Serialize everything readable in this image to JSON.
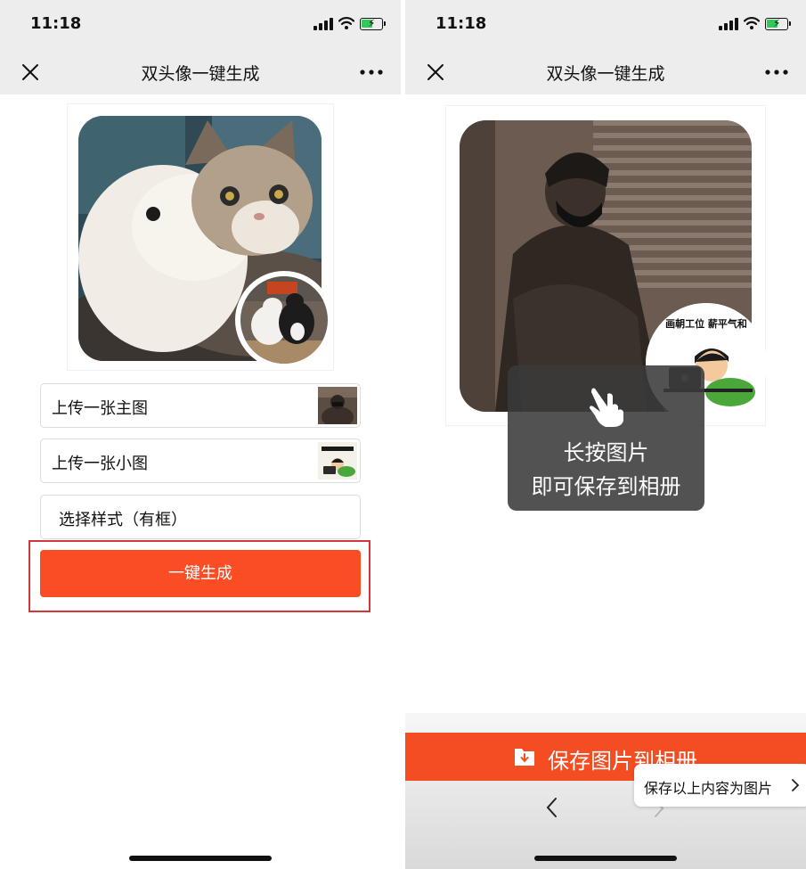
{
  "status_bar": {
    "time": "11:18"
  },
  "left_screen": {
    "nav": {
      "title": "双头像一键生成"
    },
    "fields": [
      {
        "label": "上传一张主图"
      },
      {
        "label": "上传一张小图"
      },
      {
        "label": "选择样式（有框）"
      }
    ],
    "generate_button": "一键生成",
    "highlight_color": "#d3373b"
  },
  "right_screen": {
    "nav": {
      "title": "双头像一键生成"
    },
    "small_avatar_text": "画朝工位 薪平气和",
    "toast": {
      "line1": "长按图片",
      "line2": "即可保存到相册"
    },
    "save_bar_label": "保存图片到相册",
    "save_popup_label": "保存以上内容为图片"
  },
  "colors": {
    "accent": "#fb4d24",
    "nav_bg": "#ededed",
    "toast_bg": "#3a3a3a"
  },
  "icons": [
    "close-icon",
    "more-icon",
    "cellular-signal-icon",
    "wifi-icon",
    "battery-charging-icon",
    "hand-pointer-icon",
    "download-icon",
    "chevron-left-icon",
    "chevron-right-icon"
  ]
}
